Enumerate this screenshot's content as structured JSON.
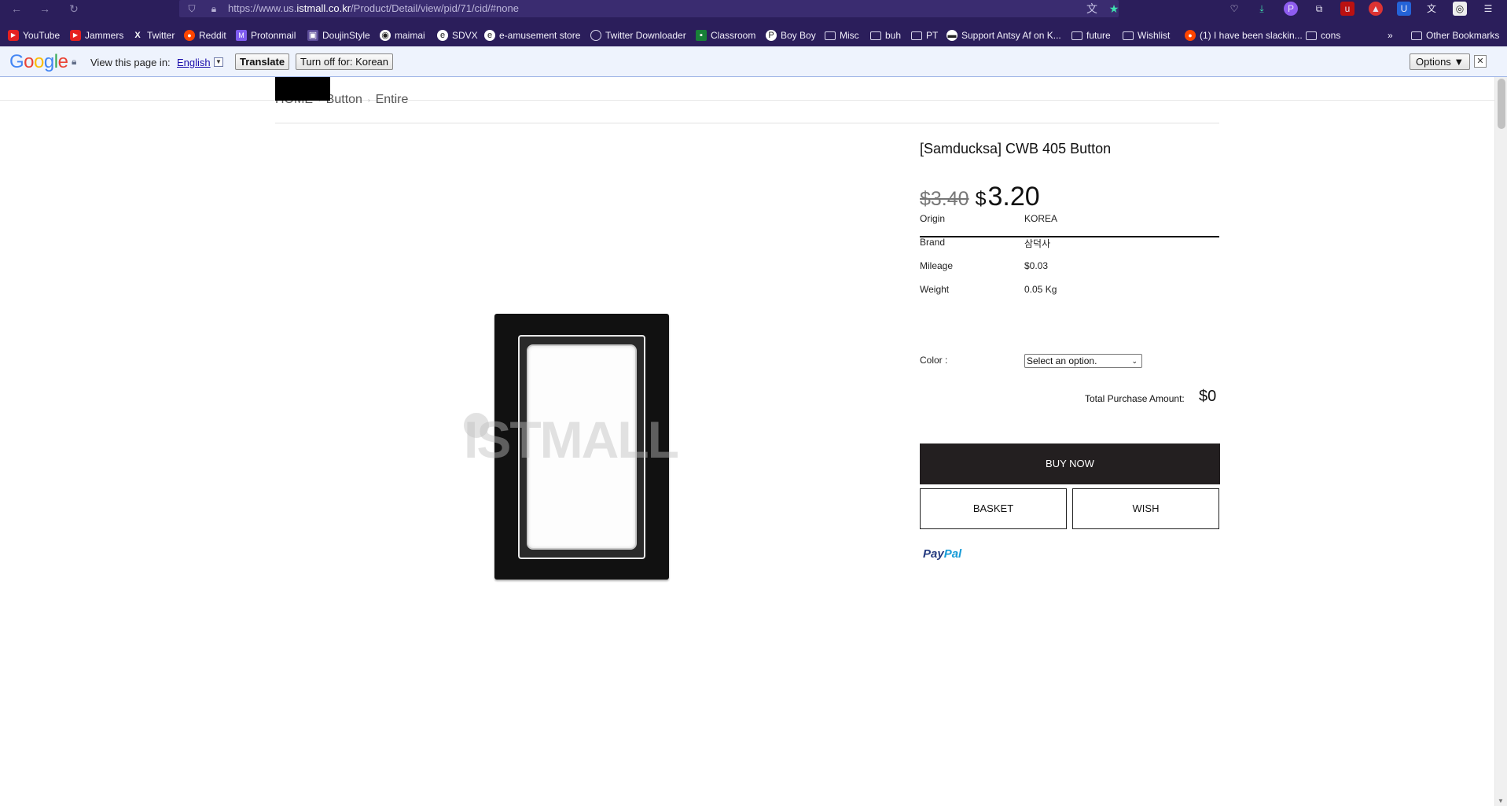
{
  "browser": {
    "url_prefix": "https://www.us.",
    "url_domain": "istmall.co.kr",
    "url_path": "/Product/Detail/view/pid/71/cid/#none",
    "icons": {
      "back": "arrow-left-icon",
      "forward": "arrow-right-icon",
      "reload": "reload-icon",
      "shield": "shield-icon",
      "lock": "lock-icon",
      "translate": "translate-icon",
      "bookmark_star": "star-icon"
    },
    "toolbar_icons": [
      "pocket-icon",
      "download-icon",
      "profile-icon",
      "extensions-icon",
      "extension-icon",
      "extension-icon",
      "extension-icon",
      "extension-icon",
      "extension-icon",
      "menu-icon"
    ],
    "bookmarks": [
      {
        "label": "YouTube",
        "icon": "youtube-icon"
      },
      {
        "label": "Jammers",
        "icon": "youtube-icon"
      },
      {
        "label": "Twitter",
        "icon": "x-icon"
      },
      {
        "label": "Reddit",
        "icon": "reddit-icon"
      },
      {
        "label": "Protonmail",
        "icon": "protonmail-icon"
      },
      {
        "label": "DoujinStyle",
        "icon": "site-icon"
      },
      {
        "label": "maimai",
        "icon": "site-icon"
      },
      {
        "label": "SDVX",
        "icon": "site-icon"
      },
      {
        "label": "e-amusement store",
        "icon": "site-icon"
      },
      {
        "label": "Twitter Downloader",
        "icon": "globe-icon"
      },
      {
        "label": "Classroom",
        "icon": "classroom-icon"
      },
      {
        "label": "Boy Boy",
        "icon": "site-icon"
      },
      {
        "label": "Misc",
        "icon": "folder-icon"
      },
      {
        "label": "buh",
        "icon": "folder-icon"
      },
      {
        "label": "PT",
        "icon": "folder-icon"
      },
      {
        "label": "Support Antsy Af on K...",
        "icon": "site-icon"
      },
      {
        "label": "future",
        "icon": "folder-icon"
      },
      {
        "label": "Wishlist",
        "icon": "folder-icon"
      },
      {
        "label": "(1) I have been slackin...",
        "icon": "reddit-icon"
      },
      {
        "label": "cons",
        "icon": "folder-icon"
      }
    ],
    "overflow_chevron": "»",
    "other_bookmarks": "Other Bookmarks"
  },
  "translate_bar": {
    "view_label": "View this page in:",
    "language": "English",
    "translate_button": "Translate",
    "turn_off_button": "Turn off for: Korean",
    "options_button": "Options ▼",
    "close": "✕"
  },
  "page": {
    "breadcrumb": [
      "HOME",
      "Button",
      "Entire"
    ],
    "watermark": "ISTMALL",
    "product": {
      "title": "[Samducksa] CWB 405 Button",
      "price_old": "$3.40",
      "price_currency": "$",
      "price_new": "3.20",
      "specs": [
        {
          "label": "Origin",
          "value": "KOREA"
        },
        {
          "label": "Brand",
          "value": "삼덕사"
        },
        {
          "label": "Mileage",
          "value": "$0.03"
        },
        {
          "label": "Weight",
          "value": "0.05 Kg"
        }
      ],
      "color_label": "Color :",
      "color_selected": "Select an option.",
      "total_label": "Total Purchase Amount:",
      "total_value": "$0",
      "buy_now": "BUY NOW",
      "basket": "BASKET",
      "wish": "WISH",
      "paypal_pay": "Pay",
      "paypal_pal": "Pal"
    }
  }
}
